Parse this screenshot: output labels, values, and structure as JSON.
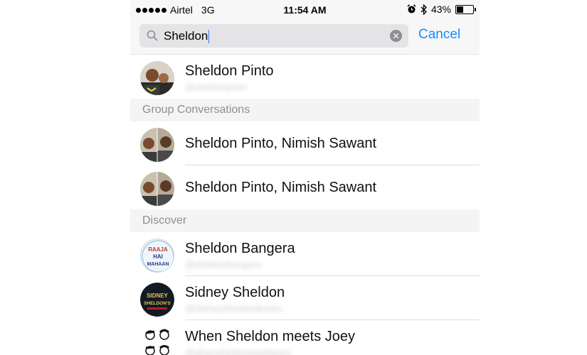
{
  "status_bar": {
    "carrier": "Airtel",
    "network": "3G",
    "time": "11:54 AM",
    "battery": "43%",
    "battery_level": 0.43,
    "icons": [
      "alarm-icon",
      "bluetooth-icon",
      "battery-icon"
    ]
  },
  "search": {
    "query": "Sheldon",
    "cancel_label": "Cancel"
  },
  "contacts": [
    {
      "name": "Sheldon Pinto",
      "handle": "@sheldonpinto"
    }
  ],
  "group_conversations": {
    "header": "Group Conversations",
    "items": [
      {
        "name": "Sheldon Pinto, Nimish Sawant"
      },
      {
        "name": "Sheldon Pinto, Nimish Sawant"
      }
    ]
  },
  "discover": {
    "header": "Discover",
    "items": [
      {
        "name": "Sheldon Bangera",
        "handle": "@sheldonbangera",
        "avatar_text": "RAAJA HAI MAHAAN"
      },
      {
        "name": "Sidney Sheldon",
        "handle": "@SidneySheldonBooks",
        "avatar_text": "SIDNEY SHELDON'S"
      },
      {
        "name": "When Sheldon meets Joey",
        "handle": "@whensheldonmeetsjoey"
      }
    ]
  },
  "colors": {
    "accent": "#1a8cff",
    "section_bg": "#f4f4f5",
    "section_text": "#8e8e93"
  }
}
